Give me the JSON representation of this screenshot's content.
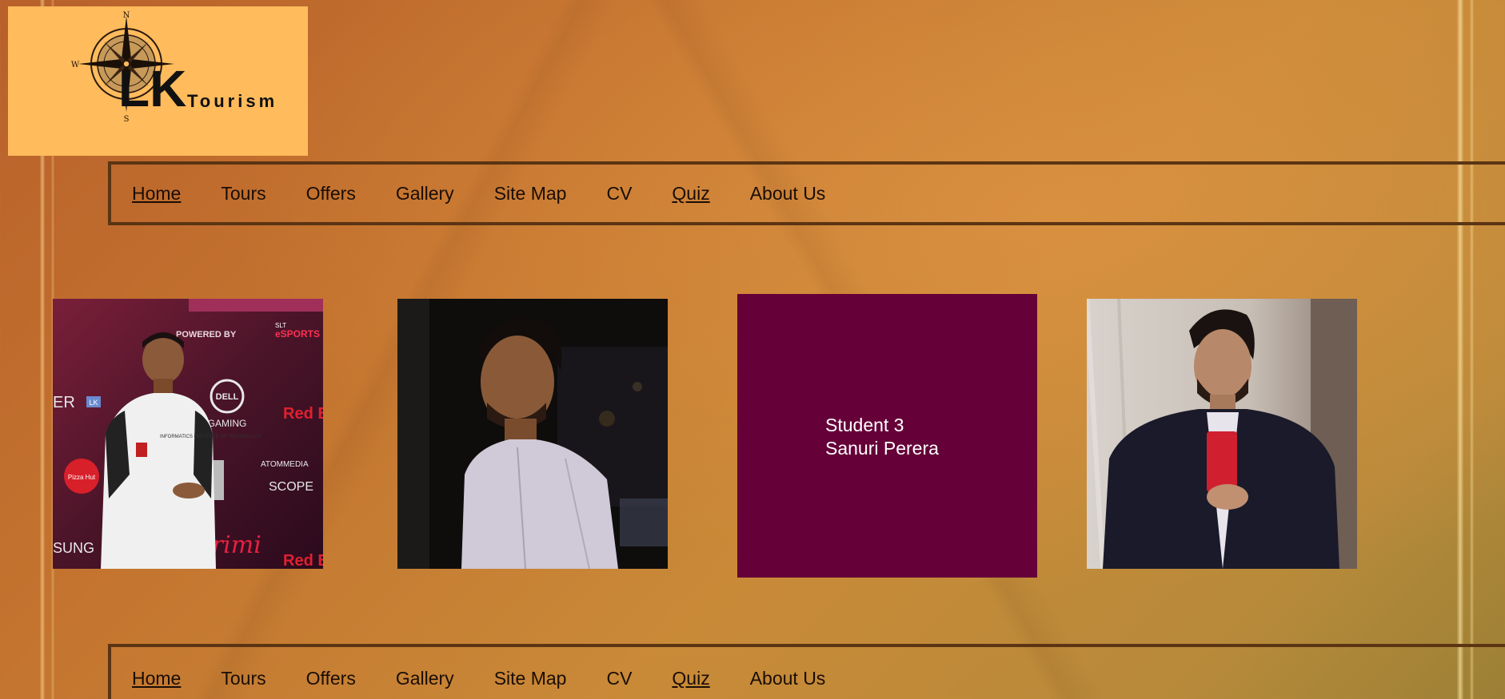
{
  "logo": {
    "brand_letters": "LK",
    "brand_word": "Tourism",
    "compass_n": "N",
    "compass_s": "S",
    "compass_w": "W",
    "background_color": "#ffbb5c"
  },
  "nav_top": {
    "items": [
      {
        "label": "Home",
        "underlined": true
      },
      {
        "label": "Tours",
        "underlined": false
      },
      {
        "label": "Offers",
        "underlined": false
      },
      {
        "label": "Gallery",
        "underlined": false
      },
      {
        "label": "Site Map",
        "underlined": false
      },
      {
        "label": "CV",
        "underlined": false
      },
      {
        "label": "Quiz",
        "underlined": true
      },
      {
        "label": "About Us",
        "underlined": false
      }
    ]
  },
  "nav_bottom": {
    "items": [
      {
        "label": "Home",
        "underlined": true
      },
      {
        "label": "Tours",
        "underlined": false
      },
      {
        "label": "Offers",
        "underlined": false
      },
      {
        "label": "Gallery",
        "underlined": false
      },
      {
        "label": "Site Map",
        "underlined": false
      },
      {
        "label": "CV",
        "underlined": false
      },
      {
        "label": "Quiz",
        "underlined": true
      },
      {
        "label": "About Us",
        "underlined": false
      }
    ]
  },
  "students": {
    "card": {
      "title": "Student 3",
      "name": "Sanuri Perera",
      "background_color": "#650038"
    },
    "photo_1_texts": {
      "powered_by": "POWERED BY",
      "slt": "SLT",
      "esports": "eSPORTS",
      "dell": "DELL",
      "gaming": "GAMING",
      "red_bull_top": "Red B",
      "gamer_lk": "ER",
      "lk_badge": "LK",
      "atom": "ATOMMEDIA",
      "scope": "SCOPE",
      "samsung": "SUNG",
      "red_bull_bottom": "Red B",
      "pizza_hut": "Pizza Hut",
      "shirt_text": "INFORMATICS INSTITUTE OF TECHNOLOGY"
    }
  }
}
